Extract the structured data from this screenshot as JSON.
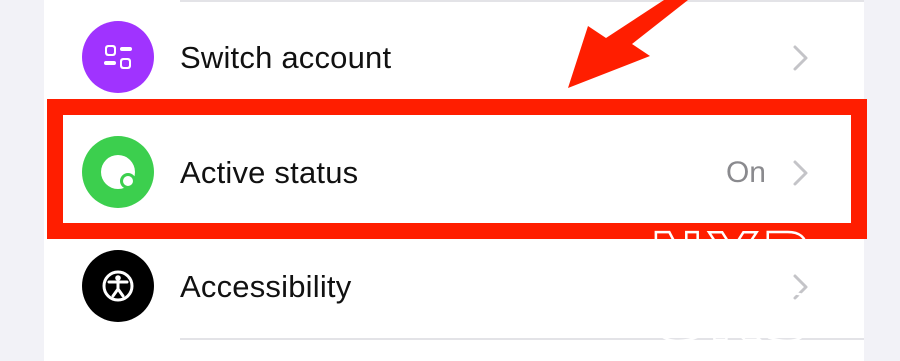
{
  "settings": {
    "items": [
      {
        "label": "Switch account",
        "value": "",
        "icon": "switch-account-icon",
        "color": "#a033ff"
      },
      {
        "label": "Active status",
        "value": "On",
        "icon": "active-status-icon",
        "color": "#3ccf4e"
      },
      {
        "label": "Accessibility",
        "value": "",
        "icon": "accessibility-icon",
        "color": "#000000"
      }
    ]
  },
  "annotation": {
    "highlight_color": "#ff1e00"
  },
  "watermark": {
    "line1": "NYP",
    "line2": "GKS"
  }
}
